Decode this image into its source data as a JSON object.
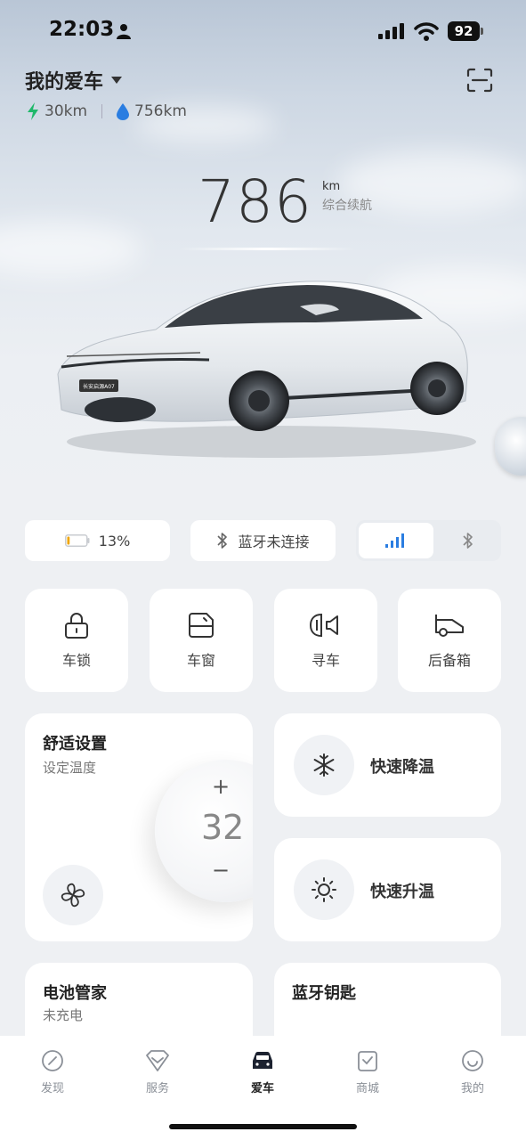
{
  "status": {
    "time": "22:03",
    "battery": "92"
  },
  "header": {
    "title": "我的爱车",
    "electric_range": "30km",
    "fuel_range": "756km"
  },
  "range": {
    "value": "786",
    "unit": "km",
    "label": "综合续航"
  },
  "car": {
    "plate": "长安启源A07"
  },
  "info": {
    "battery_percent": "13%",
    "battery_level": 0.13,
    "bluetooth_status": "蓝牙未连接"
  },
  "controls": [
    {
      "label": "车锁"
    },
    {
      "label": "车窗"
    },
    {
      "label": "寻车"
    },
    {
      "label": "后备箱"
    }
  ],
  "comfort": {
    "title": "舒适设置",
    "subtitle": "设定温度",
    "temperature": "32",
    "plus": "+",
    "minus": "−"
  },
  "quick": {
    "cool": "快速降温",
    "heat": "快速升温"
  },
  "battery_manager": {
    "title": "电池管家",
    "status": "未充电"
  },
  "bt_key": {
    "title": "蓝牙钥匙"
  },
  "tabs": [
    {
      "label": "发现",
      "icon": "compass-icon"
    },
    {
      "label": "服务",
      "icon": "heart-diamond-icon"
    },
    {
      "label": "爱车",
      "icon": "car-icon",
      "active": true
    },
    {
      "label": "商城",
      "icon": "bag-icon"
    },
    {
      "label": "我的",
      "icon": "smile-icon"
    }
  ],
  "colors": {
    "electric": "#1fb86a",
    "fuel": "#2a7de1",
    "battery_low": "#f0a500",
    "signal_active": "#2a7de1"
  }
}
